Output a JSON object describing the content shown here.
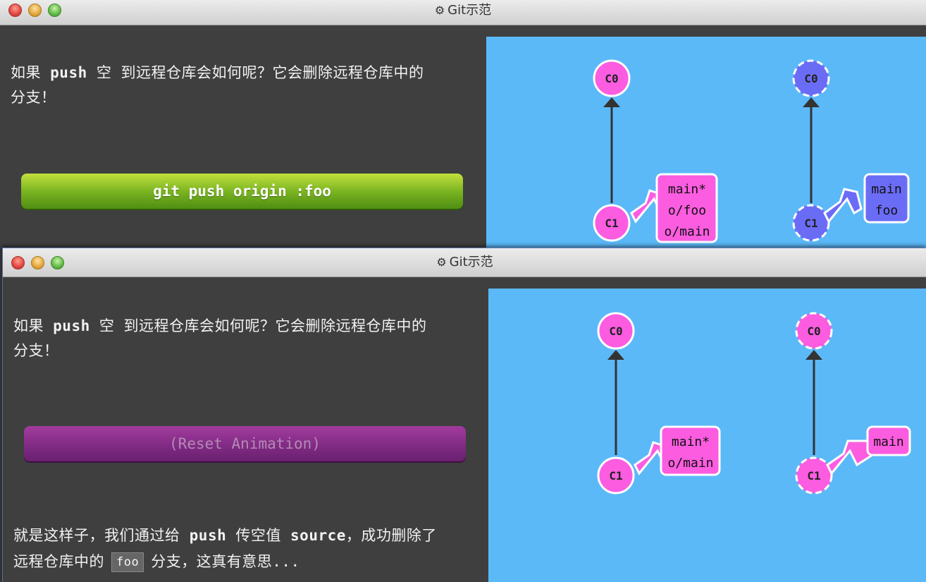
{
  "window1": {
    "title": "Git示范",
    "text_before_push": "如果 ",
    "text_push": "push",
    "text_after_push": " 空 到远程仓库会如何呢？它会删除远程仓库中的",
    "text_line2": "分支！",
    "command_button": "git push origin :foo",
    "local_repo": {
      "commits": [
        "C0",
        "C1"
      ],
      "branch_label": [
        "main*",
        "o/foo",
        "o/main"
      ]
    },
    "remote_repo": {
      "commits": [
        "C0",
        "C1"
      ],
      "branch_label": [
        "main",
        "foo"
      ]
    }
  },
  "window2": {
    "title": "Git示范",
    "text_before_push": "如果 ",
    "text_push": "push",
    "text_after_push": " 空 到远程仓库会如何呢？它会删除远程仓库中的",
    "text_line2": "分支！",
    "reset_button": "(Reset Animation)",
    "local_repo": {
      "commits": [
        "C0",
        "C1"
      ],
      "branch_label": [
        "main*",
        "o/main"
      ]
    },
    "remote_repo": {
      "commits": [
        "C0",
        "C1"
      ],
      "branch_label": [
        "main"
      ]
    },
    "bottom_text": {
      "part1": "就是这样子，我们通过给 ",
      "push": "push",
      "part2": " 传空值 ",
      "source": "source",
      "part3": "，成功删除了",
      "line2_part1": "远程仓库中的",
      "chip": "foo",
      "line2_part2": "分支，这真有意思..."
    }
  },
  "colors": {
    "canvas_bg": "#5cb9f8",
    "commit_pink": "#fc5ce0",
    "commit_blue": "#6b6cf6",
    "edge": "#333333"
  }
}
